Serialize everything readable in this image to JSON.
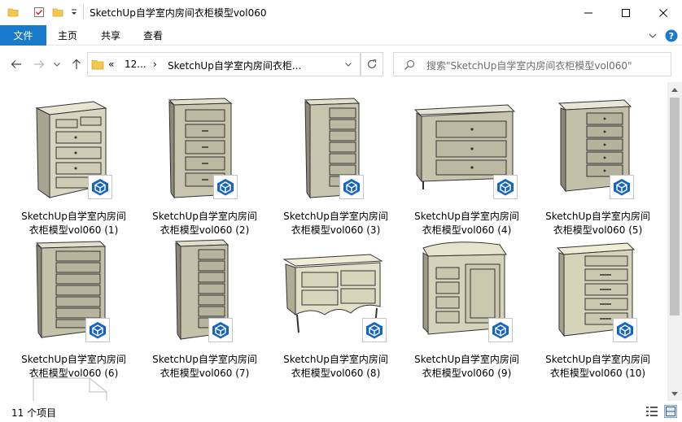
{
  "window": {
    "title": "SketchUp自学室内房间衣柜模型vol060",
    "quick_access_icons": [
      "folder-icon",
      "properties-checkmark-icon",
      "new-folder-icon",
      "customize-dropdown-icon"
    ],
    "controls": [
      "minimize-icon",
      "maximize-icon",
      "close-icon"
    ]
  },
  "ribbon": {
    "file_tab": "文件",
    "tabs": [
      "主页",
      "共享",
      "查看"
    ],
    "accent_color": "#1979ca",
    "right_icons": [
      "expand-ribbon-icon",
      "help-icon"
    ]
  },
  "nav": {
    "back_icon": "back-arrow-icon",
    "forward_icon": "forward-arrow-icon",
    "recent_icon": "recent-dropdown-icon",
    "up_icon": "up-arrow-icon"
  },
  "address": {
    "overflow": "«",
    "crumbs": [
      "12...",
      "SketchUp自学室内房间衣柜..."
    ],
    "separator": "›"
  },
  "search": {
    "placeholder": "搜索\"SketchUp自学室内房间衣柜模型vol060\""
  },
  "files": [
    {
      "name": "SketchUp自学室内房间衣柜模型vol060 (1)",
      "line1": "SketchUp自学室内房间",
      "line2": "衣柜模型vol060 (1)"
    },
    {
      "name": "SketchUp自学室内房间衣柜模型vol060 (2)",
      "line1": "SketchUp自学室内房间",
      "line2": "衣柜模型vol060 (2)"
    },
    {
      "name": "SketchUp自学室内房间衣柜模型vol060 (3)",
      "line1": "SketchUp自学室内房间",
      "line2": "衣柜模型vol060 (3)"
    },
    {
      "name": "SketchUp自学室内房间衣柜模型vol060 (4)",
      "line1": "SketchUp自学室内房间",
      "line2": "衣柜模型vol060 (4)"
    },
    {
      "name": "SketchUp自学室内房间衣柜模型vol060 (5)",
      "line1": "SketchUp自学室内房间",
      "line2": "衣柜模型vol060 (5)"
    },
    {
      "name": "SketchUp自学室内房间衣柜模型vol060 (6)",
      "line1": "SketchUp自学室内房间",
      "line2": "衣柜模型vol060 (6)"
    },
    {
      "name": "SketchUp自学室内房间衣柜模型vol060 (7)",
      "line1": "SketchUp自学室内房间",
      "line2": "衣柜模型vol060 (7)"
    },
    {
      "name": "SketchUp自学室内房间衣柜模型vol060 (8)",
      "line1": "SketchUp自学室内房间",
      "line2": "衣柜模型vol060 (8)"
    },
    {
      "name": "SketchUp自学室内房间衣柜模型vol060 (9)",
      "line1": "SketchUp自学室内房间",
      "line2": "衣柜模型vol060 (9)"
    },
    {
      "name": "SketchUp自学室内房间衣柜模型vol060 (10)",
      "line1": "SketchUp自学室内房间",
      "line2": "衣柜模型vol060 (10)"
    }
  ],
  "partial_file_icon": "text-document-icon",
  "status": {
    "item_count": "11 个项目",
    "view_icons": [
      "details-view-icon",
      "large-icons-view-icon"
    ]
  }
}
